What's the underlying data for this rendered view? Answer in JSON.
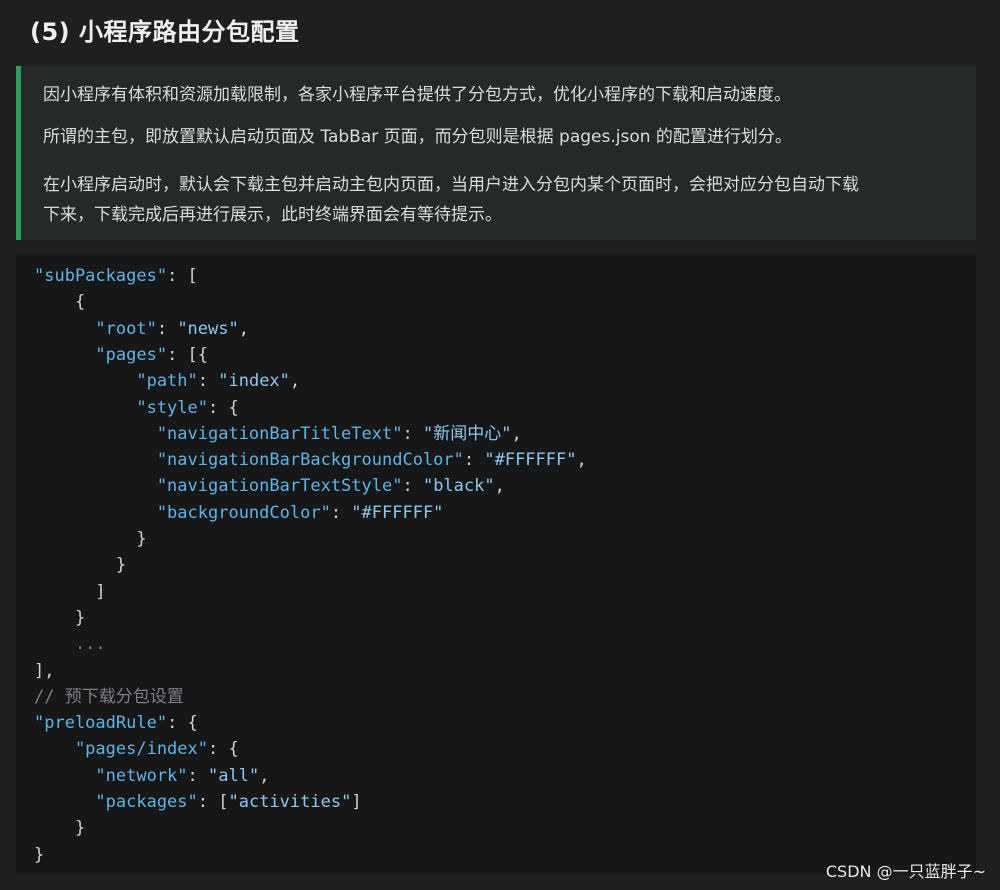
{
  "heading": "(5) 小程序路由分包配置",
  "callout": {
    "paragraphs": [
      "因小程序有体积和资源加载限制，各家小程序平台提供了分包方式，优化小程序的下载和启动速度。",
      "所谓的主包，即放置默认启动页面及 TabBar 页面，而分包则是根据 pages.json 的配置进行划分。",
      "在小程序启动时，默认会下载主包并启动主包内页面，当用户进入分包内某个页面时，会把对应分包自动下载",
      "下来，下载完成后再进行展示，此时终端界面会有等待提示。"
    ]
  },
  "code": {
    "lines": [
      [
        {
          "t": "\"subPackages\"",
          "c": "k"
        },
        {
          "t": ": [",
          "c": "p"
        }
      ],
      [
        {
          "t": "    {",
          "c": "p"
        }
      ],
      [
        {
          "t": "      \"root\"",
          "c": "k"
        },
        {
          "t": ": ",
          "c": "p"
        },
        {
          "t": "\"news\"",
          "c": "s"
        },
        {
          "t": ",",
          "c": "p"
        }
      ],
      [
        {
          "t": "      \"pages\"",
          "c": "k"
        },
        {
          "t": ": [{",
          "c": "p"
        }
      ],
      [
        {
          "t": "          \"path\"",
          "c": "k"
        },
        {
          "t": ": ",
          "c": "p"
        },
        {
          "t": "\"index\"",
          "c": "s"
        },
        {
          "t": ",",
          "c": "p"
        }
      ],
      [
        {
          "t": "          \"style\"",
          "c": "k"
        },
        {
          "t": ": {",
          "c": "p"
        }
      ],
      [
        {
          "t": "            \"navigationBarTitleText\"",
          "c": "k"
        },
        {
          "t": ": ",
          "c": "p"
        },
        {
          "t": "\"新闻中心\"",
          "c": "s"
        },
        {
          "t": ",",
          "c": "p"
        }
      ],
      [
        {
          "t": "            \"navigationBarBackgroundColor\"",
          "c": "k"
        },
        {
          "t": ": ",
          "c": "p"
        },
        {
          "t": "\"#FFFFFF\"",
          "c": "s"
        },
        {
          "t": ",",
          "c": "p"
        }
      ],
      [
        {
          "t": "            \"navigationBarTextStyle\"",
          "c": "k"
        },
        {
          "t": ": ",
          "c": "p"
        },
        {
          "t": "\"black\"",
          "c": "s"
        },
        {
          "t": ",",
          "c": "p"
        }
      ],
      [
        {
          "t": "            \"backgroundColor\"",
          "c": "k"
        },
        {
          "t": ": ",
          "c": "p"
        },
        {
          "t": "\"#FFFFFF\"",
          "c": "s"
        }
      ],
      [
        {
          "t": "          }",
          "c": "p"
        }
      ],
      [
        {
          "t": "        }",
          "c": "p"
        }
      ],
      [
        {
          "t": "      ]",
          "c": "p"
        }
      ],
      [
        {
          "t": "    }",
          "c": "p"
        }
      ],
      [
        {
          "t": "    ...",
          "c": "c"
        }
      ],
      [
        {
          "t": "],",
          "c": "p"
        }
      ],
      [
        {
          "t": "// 预下载分包设置",
          "c": "c"
        }
      ],
      [
        {
          "t": "\"preloadRule\"",
          "c": "k"
        },
        {
          "t": ": {",
          "c": "p"
        }
      ],
      [
        {
          "t": "    \"pages/index\"",
          "c": "k"
        },
        {
          "t": ": {",
          "c": "p"
        }
      ],
      [
        {
          "t": "      \"network\"",
          "c": "k"
        },
        {
          "t": ": ",
          "c": "p"
        },
        {
          "t": "\"all\"",
          "c": "s"
        },
        {
          "t": ",",
          "c": "p"
        }
      ],
      [
        {
          "t": "      \"packages\"",
          "c": "k"
        },
        {
          "t": ": [",
          "c": "p"
        },
        {
          "t": "\"activities\"",
          "c": "s"
        },
        {
          "t": "]",
          "c": "p"
        }
      ],
      [
        {
          "t": "    }",
          "c": "p"
        }
      ],
      [
        {
          "t": "}",
          "c": "p"
        }
      ]
    ]
  },
  "watermark": "CSDN @一只蓝胖子~",
  "colors": {
    "accent_border": "#2e9e5b",
    "code_key": "#5fb4e6",
    "code_string": "#8ec7ee",
    "code_comment": "#7c7f83"
  }
}
